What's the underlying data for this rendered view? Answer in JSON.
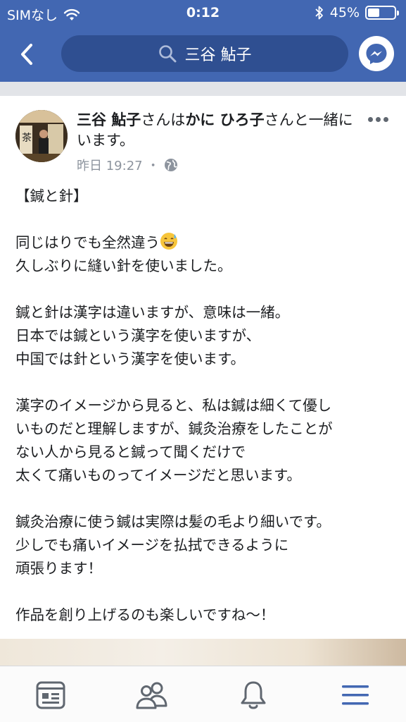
{
  "status_bar": {
    "carrier": "SIMなし",
    "time": "0:12",
    "battery": "45%",
    "battery_level": 0.45,
    "icons": [
      "wifi-icon",
      "bluetooth-icon",
      "battery-icon"
    ]
  },
  "nav": {
    "search_text": "三谷 鮎子",
    "icons": [
      "back-chevron-icon",
      "search-icon",
      "messenger-icon"
    ]
  },
  "post": {
    "author_name": "三谷 鮎子",
    "with_prefix": "さんは",
    "tagged_name": "かに ひろ子",
    "with_suffix": "さんと一緒にいます。",
    "timestamp": "昨日 19:27",
    "separator": "・",
    "privacy_icon": "globe-icon",
    "lines": [
      "【鍼と針】",
      "",
      "同じはりでも全然違う",
      "久しぶりに縫い針を使いました。",
      "",
      "鍼と針は漢字は違いますが、意味は一緒。",
      "日本では鍼という漢字を使いますが、",
      "中国では針という漢字を使います。",
      "",
      "漢字のイメージから見ると、私は鍼は細くて優し",
      "いものだと理解しますが、鍼灸治療をしたことが",
      "ない人から見ると鍼って聞くだけで",
      "太くて痛いものってイメージだと思います。",
      "",
      "鍼灸治療に使う鍼は実際は髪の毛より細いです。",
      "少しでも痛いイメージを払拭できるように",
      "頑張ります！",
      "",
      "作品を創り上げるのも楽しいですね〜！"
    ],
    "emoji_after_line": 2,
    "emoji_name": "grinning-sweat-emoji"
  },
  "tabbar": {
    "tabs": [
      "news-feed-icon",
      "friends-icon",
      "notifications-icon",
      "menu-icon"
    ],
    "active_color": "#4267b2",
    "inactive_color": "#606770"
  },
  "colors": {
    "brand": "#4267b2",
    "search_bg": "#2f4f91",
    "text": "#1c1e21",
    "meta": "#8d949e"
  }
}
